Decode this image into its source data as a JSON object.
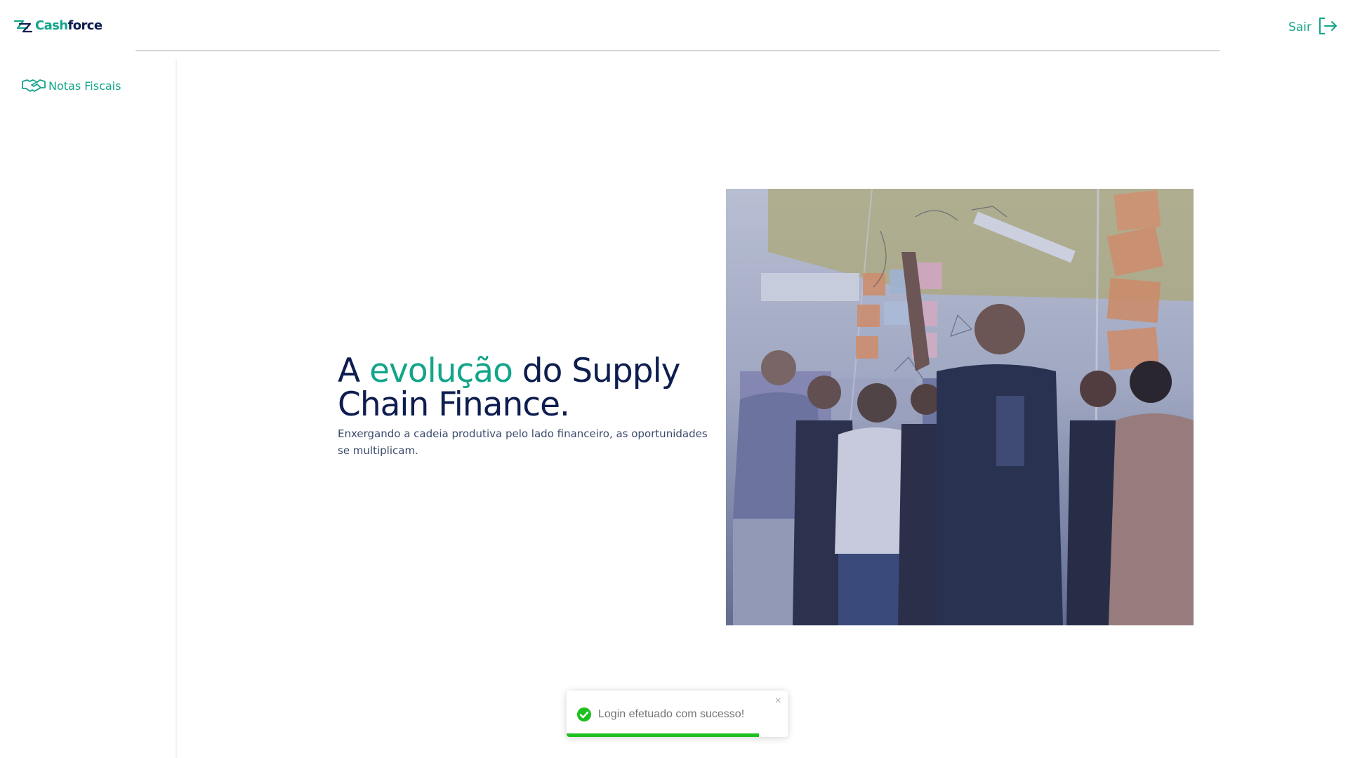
{
  "header": {
    "logo": {
      "part1": "Cash",
      "part2": "force"
    },
    "logout_label": "Sair"
  },
  "sidebar": {
    "items": [
      {
        "label": "Notas Fiscais",
        "icon": "handshake-icon"
      }
    ]
  },
  "hero": {
    "title_prefix": "A ",
    "title_accent": "evolução",
    "title_suffix": " do Supply Chain Finance.",
    "subtitle": "Enxergando a cadeia produtiva pelo lado financeiro, as oportunidades se multiplicam.",
    "image_icon": "team-photo"
  },
  "toast": {
    "message": "Login efetuado com sucesso!",
    "close_label": "×",
    "progress": 0.87,
    "icon": "check-circle-icon"
  },
  "colors": {
    "brand_green": "#12a58a",
    "brand_navy": "#0e1d4f",
    "success": "#1ec01e"
  }
}
